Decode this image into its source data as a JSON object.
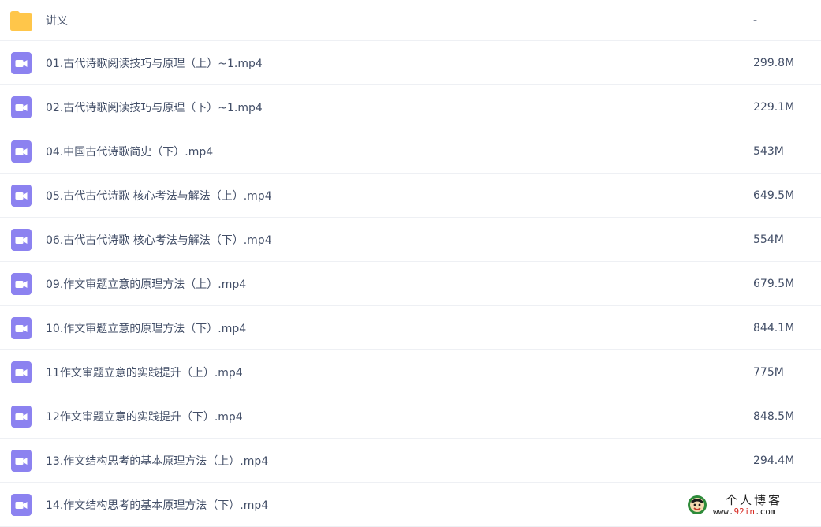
{
  "files": [
    {
      "type": "folder",
      "icon": "folder-icon",
      "name": "讲义",
      "size": "-"
    },
    {
      "type": "video",
      "icon": "video-file-icon",
      "name": "01.古代诗歌阅读技巧与原理（上）~1.mp4",
      "size": "299.8M"
    },
    {
      "type": "video",
      "icon": "video-file-icon",
      "name": "02.古代诗歌阅读技巧与原理（下）~1.mp4",
      "size": "229.1M"
    },
    {
      "type": "video",
      "icon": "video-file-icon",
      "name": "04.中国古代诗歌简史（下）.mp4",
      "size": "543M"
    },
    {
      "type": "video",
      "icon": "video-file-icon",
      "name": "05.古代古代诗歌 核心考法与解法（上）.mp4",
      "size": "649.5M"
    },
    {
      "type": "video",
      "icon": "video-file-icon",
      "name": "06.古代古代诗歌 核心考法与解法（下）.mp4",
      "size": "554M"
    },
    {
      "type": "video",
      "icon": "video-file-icon",
      "name": "09.作文审题立意的原理方法（上）.mp4",
      "size": "679.5M"
    },
    {
      "type": "video",
      "icon": "video-file-icon",
      "name": "10.作文审题立意的原理方法（下）.mp4",
      "size": "844.1M"
    },
    {
      "type": "video",
      "icon": "video-file-icon",
      "name": "11作文审题立意的实践提升（上）.mp4",
      "size": "775M"
    },
    {
      "type": "video",
      "icon": "video-file-icon",
      "name": "12作文审题立意的实践提升（下）.mp4",
      "size": "848.5M"
    },
    {
      "type": "video",
      "icon": "video-file-icon",
      "name": "13.作文结构思考的基本原理方法（上）.mp4",
      "size": "294.4M"
    },
    {
      "type": "video",
      "icon": "video-file-icon",
      "name": "14.作文结构思考的基本原理方法（下）.mp4",
      "size": ""
    }
  ],
  "watermark": {
    "title": "个人博客",
    "url_prefix": "www.",
    "url_highlight": "92in",
    "url_suffix": ".com"
  },
  "colors": {
    "folder": "#ffc64a",
    "video_icon": "#8c82f0",
    "text": "#424e67",
    "divider": "#eef0f4"
  }
}
